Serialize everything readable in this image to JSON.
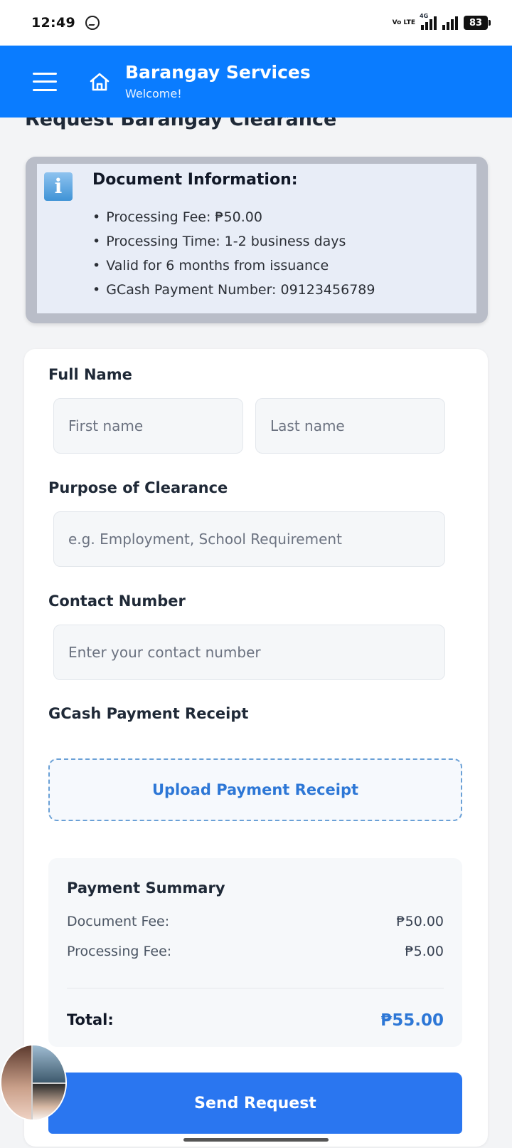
{
  "status_bar": {
    "time": "12:49",
    "network_volte": "Vo LTE",
    "network_type": "4G",
    "battery": "83"
  },
  "header": {
    "title": "Barangay Services",
    "subtitle": "Welcome!"
  },
  "page_title": "Request Barangay Clearance",
  "info": {
    "icon": "info-icon",
    "title": "Document Information:",
    "items": [
      "Processing Fee: ₱50.00",
      "Processing Time: 1-2 business days",
      "Valid for 6 months from issuance",
      "GCash Payment Number: 09123456789"
    ]
  },
  "form": {
    "full_name_label": "Full Name",
    "first_name_placeholder": "First name",
    "last_name_placeholder": "Last name",
    "purpose_label": "Purpose of Clearance",
    "purpose_placeholder": "e.g. Employment, School Requirement",
    "contact_label": "Contact Number",
    "contact_placeholder": "Enter your contact number",
    "receipt_label": "GCash Payment Receipt",
    "upload_label": "Upload Payment Receipt"
  },
  "summary": {
    "title": "Payment Summary",
    "document_fee_label": "Document Fee:",
    "document_fee": "₱50.00",
    "processing_fee_label": "Processing Fee:",
    "processing_fee": "₱5.00",
    "total_label": "Total:",
    "total": "₱55.00"
  },
  "send_button": "Send Request",
  "colors": {
    "header": "#0a7cff",
    "accent": "#2d77d6",
    "button": "#2a76f0"
  }
}
